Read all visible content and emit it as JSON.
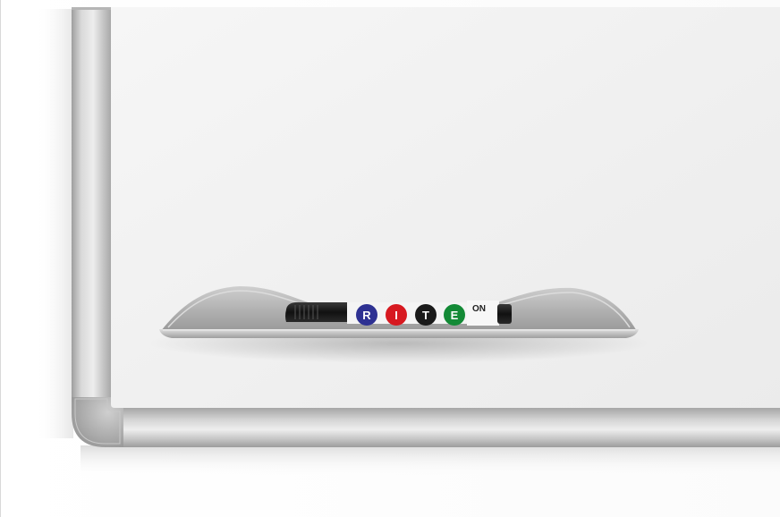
{
  "product": {
    "marker_brand_letters": [
      "R",
      "I",
      "T",
      "E"
    ],
    "marker_cap_text": "ON"
  },
  "colors": {
    "board_surface": "#efefef",
    "frame": "#bdbdbd",
    "marker_body": "#1a1a1a",
    "letter_R": "#2e3192",
    "letter_I": "#d71920",
    "letter_T": "#1a1a1a",
    "letter_E": "#138a36"
  }
}
